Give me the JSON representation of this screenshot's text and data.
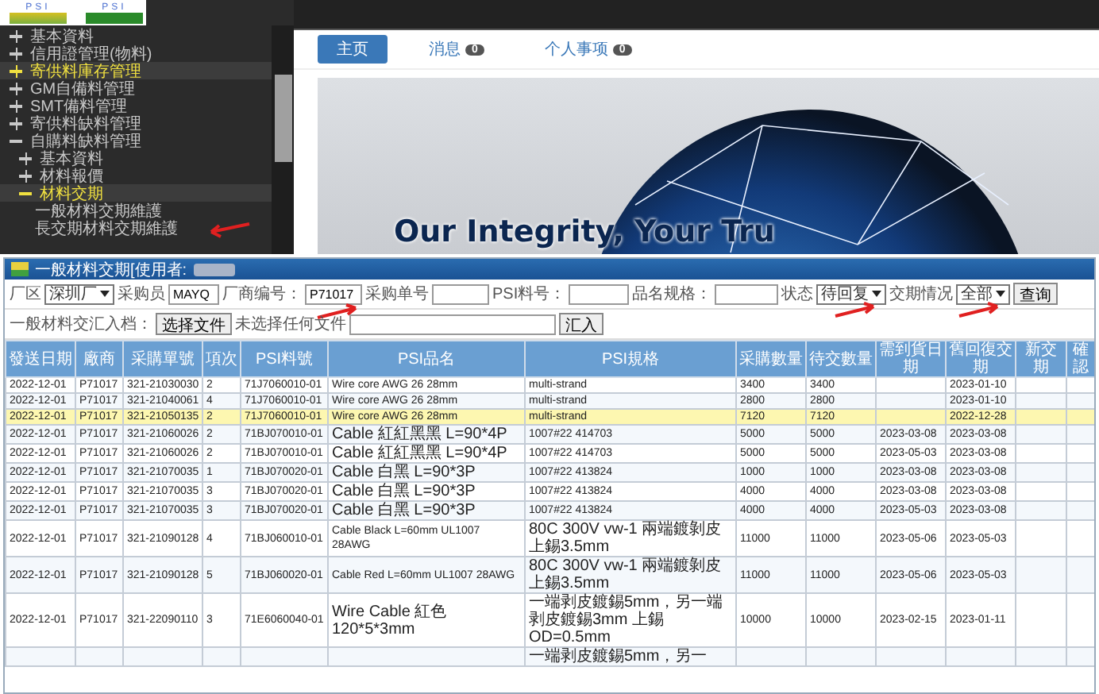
{
  "logos": [
    {
      "text": "PSI"
    },
    {
      "text": "PSI"
    }
  ],
  "sidebar": {
    "items": [
      {
        "label": "基本資料",
        "kind": "folder",
        "expanded": false,
        "selected": false
      },
      {
        "label": "信用證管理(物料)",
        "kind": "folder",
        "expanded": false,
        "selected": false
      },
      {
        "label": "寄供料庫存管理",
        "kind": "folder",
        "expanded": false,
        "selected": true
      },
      {
        "label": "GM自備料管理",
        "kind": "folder",
        "expanded": false,
        "selected": false
      },
      {
        "label": "SMT備料管理",
        "kind": "folder",
        "expanded": false,
        "selected": false
      },
      {
        "label": "寄供料缺料管理",
        "kind": "folder",
        "expanded": false,
        "selected": false
      },
      {
        "label": "自購料缺料管理",
        "kind": "folder",
        "expanded": true,
        "selected": false,
        "children": [
          {
            "label": "基本資料",
            "kind": "folder",
            "expanded": false,
            "selected": false
          },
          {
            "label": "材料報價",
            "kind": "folder",
            "expanded": false,
            "selected": false
          },
          {
            "label": "材料交期",
            "kind": "folder",
            "expanded": true,
            "selected": true,
            "children": [
              {
                "label": "一般材料交期維護",
                "kind": "leaf",
                "selected": false
              },
              {
                "label": "長交期材料交期維護",
                "kind": "leaf",
                "selected": false
              }
            ]
          }
        ]
      }
    ]
  },
  "tabs": [
    {
      "label": "主页",
      "selected": true
    },
    {
      "label": "消息",
      "badge": "0",
      "selected": false
    },
    {
      "label": "个人事项",
      "badge": "0",
      "selected": false
    }
  ],
  "banner": {
    "slogan": "Our Integrity, Your Tru"
  },
  "window": {
    "title": "一般材料交期[使用者:",
    "filters": [
      {
        "kind": "select",
        "label": "厂区",
        "value": "深圳厂"
      },
      {
        "kind": "input",
        "label": "采购员",
        "value": "MAYQ"
      },
      {
        "kind": "input",
        "label": "厂商编号：",
        "value": "P71017"
      },
      {
        "kind": "input",
        "label": "采购单号"
      },
      {
        "kind": "input",
        "label": "PSI料号："
      },
      {
        "kind": "input",
        "label": "品名规格："
      },
      {
        "kind": "select",
        "label": "状态",
        "value": "待回复"
      },
      {
        "kind": "select",
        "label": "交期情况",
        "value": "全部"
      },
      {
        "kind": "button",
        "label": "查询"
      }
    ],
    "import": {
      "label": "一般材料交汇入档：",
      "file_button": "选择文件",
      "file_status": "未选择任何文件",
      "button": "汇入"
    },
    "table": {
      "columns": [
        "發送日期",
        "廠商",
        "采購單號",
        "項次",
        "PSI料號",
        "PSI品名",
        "PSI規格",
        "采購數量",
        "待交數量",
        "需到貨日期",
        "舊回復交期",
        "新交期",
        "確認"
      ],
      "rows": [
        {
          "highlighted": false,
          "cells": [
            "2022-12-01",
            "P71017",
            "321-21030030",
            "2",
            "71J7060010-01",
            "Wire core AWG 26 28mm",
            "multi-strand",
            "3400",
            "3400",
            "",
            "2023-01-10",
            "",
            ""
          ]
        },
        {
          "highlighted": false,
          "cells": [
            "2022-12-01",
            "P71017",
            "321-21040061",
            "4",
            "71J7060010-01",
            "Wire core AWG 26 28mm",
            "multi-strand",
            "2800",
            "2800",
            "",
            "2023-01-10",
            "",
            ""
          ]
        },
        {
          "highlighted": true,
          "cells": [
            "2022-12-01",
            "P71017",
            "321-21050135",
            "2",
            "71J7060010-01",
            "Wire core AWG 26 28mm",
            "multi-strand",
            "7120",
            "7120",
            "",
            "2022-12-28",
            "",
            ""
          ]
        },
        {
          "highlighted": false,
          "cells": [
            "2022-12-01",
            "P71017",
            "321-21060026",
            "2",
            "71BJ070010-01",
            "Cable 紅紅黑黑 L=90*4P",
            "1007#22 414703",
            "5000",
            "5000",
            "2023-03-08",
            "2023-03-08",
            "",
            ""
          ]
        },
        {
          "highlighted": false,
          "cells": [
            "2022-12-01",
            "P71017",
            "321-21060026",
            "2",
            "71BJ070010-01",
            "Cable 紅紅黑黑 L=90*4P",
            "1007#22 414703",
            "5000",
            "5000",
            "2023-05-03",
            "2023-03-08",
            "",
            ""
          ]
        },
        {
          "highlighted": false,
          "cells": [
            "2022-12-01",
            "P71017",
            "321-21070035",
            "1",
            "71BJ070020-01",
            "Cable 白黑 L=90*3P",
            "1007#22 413824",
            "1000",
            "1000",
            "2023-03-08",
            "2023-03-08",
            "",
            ""
          ]
        },
        {
          "highlighted": false,
          "cells": [
            "2022-12-01",
            "P71017",
            "321-21070035",
            "3",
            "71BJ070020-01",
            "Cable 白黑 L=90*3P",
            "1007#22 413824",
            "4000",
            "4000",
            "2023-03-08",
            "2023-03-08",
            "",
            ""
          ]
        },
        {
          "highlighted": false,
          "cells": [
            "2022-12-01",
            "P71017",
            "321-21070035",
            "3",
            "71BJ070020-01",
            "Cable 白黑 L=90*3P",
            "1007#22 413824",
            "4000",
            "4000",
            "2023-05-03",
            "2023-03-08",
            "",
            ""
          ]
        },
        {
          "highlighted": false,
          "cells": [
            "2022-12-01",
            "P71017",
            "321-21090128",
            "4",
            "71BJ060010-01",
            "Cable Black L=60mm UL1007 28AWG",
            "80C 300V vw-1 兩端鍍剝皮上錫3.5mm",
            "11000",
            "11000",
            "2023-05-06",
            "2023-05-03",
            "",
            ""
          ]
        },
        {
          "highlighted": false,
          "cells": [
            "2022-12-01",
            "P71017",
            "321-21090128",
            "5",
            "71BJ060020-01",
            "Cable Red L=60mm UL1007 28AWG",
            "80C 300V vw-1 兩端鍍剝皮上錫3.5mm",
            "11000",
            "11000",
            "2023-05-06",
            "2023-05-03",
            "",
            ""
          ]
        },
        {
          "highlighted": false,
          "cells": [
            "2022-12-01",
            "P71017",
            "321-22090110",
            "3",
            "71E6060040-01",
            "Wire Cable 紅色 120*5*3mm",
            "一端剥皮鍍錫5mm，另一端剥皮鍍錫3mm 上錫OD=0.5mm",
            "10000",
            "10000",
            "2023-02-15",
            "2023-01-11",
            "",
            ""
          ]
        },
        {
          "highlighted": false,
          "cells": [
            "",
            "",
            "",
            "",
            "",
            "",
            "一端剥皮鍍錫5mm，另一",
            "",
            "",
            "",
            "",
            "",
            ""
          ]
        }
      ]
    }
  }
}
